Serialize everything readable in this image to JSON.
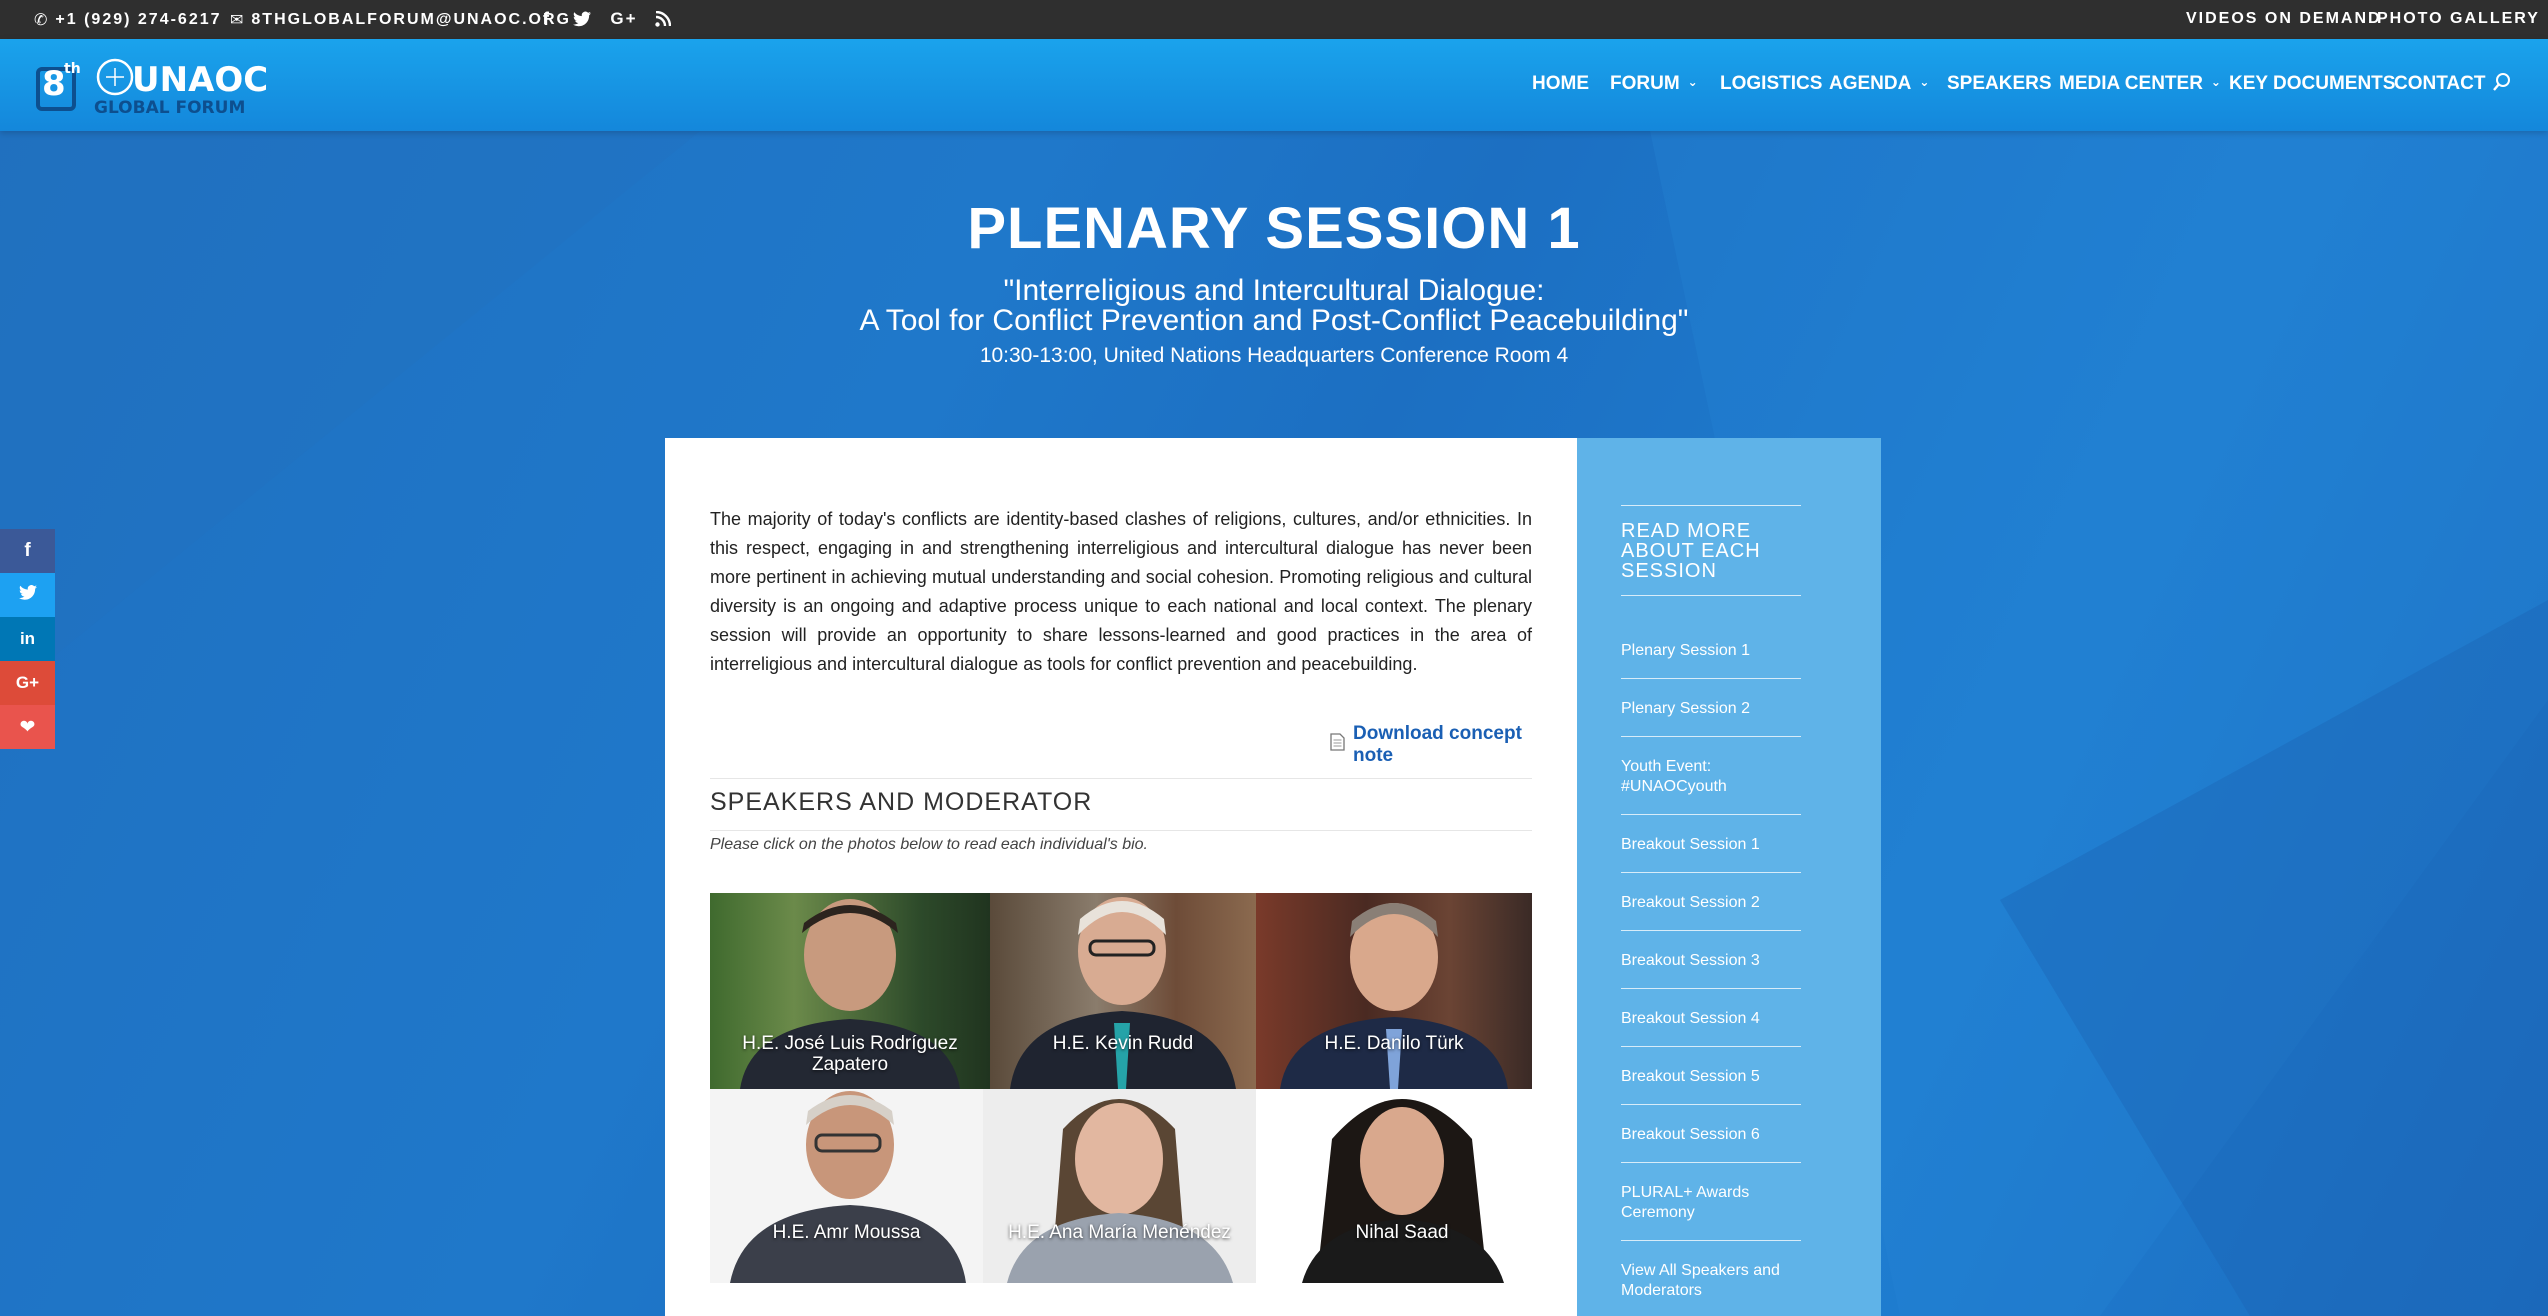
{
  "topbar": {
    "phone": "+1 (929) 274-6217",
    "email": "8THGLOBALFORUM@UNAOC.ORG",
    "social_icons": [
      "facebook-icon",
      "twitter-icon",
      "google-plus-icon",
      "rss-icon"
    ],
    "links": [
      "VIDEOS ON DEMAND",
      "PHOTO GALLERY"
    ]
  },
  "logo": {
    "number": "8",
    "superscript": "th",
    "brand": "UNAOC",
    "subtitle": "GLOBAL FORUM"
  },
  "nav": {
    "items": [
      {
        "label": "HOME",
        "dropdown": false
      },
      {
        "label": "FORUM",
        "dropdown": true
      },
      {
        "label": "LOGISTICS",
        "dropdown": false
      },
      {
        "label": "AGENDA",
        "dropdown": true
      },
      {
        "label": "SPEAKERS",
        "dropdown": false
      },
      {
        "label": "MEDIA CENTER",
        "dropdown": true
      },
      {
        "label": "KEY DOCUMENTS",
        "dropdown": false
      },
      {
        "label": "CONTACT",
        "dropdown": false
      }
    ],
    "search_icon": "search-icon"
  },
  "hero": {
    "title": "PLENARY SESSION 1",
    "subtitle_line1": "\"Interreligious and Intercultural Dialogue:",
    "subtitle_line2": "A Tool for Conflict Prevention and Post-Conflict Peacebuilding\"",
    "details": "10:30-13:00, United Nations Headquarters Conference Room 4"
  },
  "main": {
    "intro": "The majority of today's conflicts are identity-based clashes of religions, cultures, and/or ethnicities. In this respect, engaging in and strengthening interreligious and intercultural dialogue has never been more pertinent in achieving mutual understanding and social cohesion. Promoting religious and cultural diversity is an ongoing and adaptive process unique to each national and local context. The plenary session will provide an opportunity to share lessons-learned and good practices in the area of interreligious and intercultural dialogue as tools for conflict prevention and peacebuilding.",
    "download_label": "Download concept note",
    "section_title": "SPEAKERS AND MODERATOR",
    "note": "Please click on the photos below to read each individual's bio.",
    "speakers": [
      {
        "name": "H.E. José Luis Rodríguez Zapatero"
      },
      {
        "name": "H.E. Kevin Rudd"
      },
      {
        "name": "H.E. Danilo Türk"
      },
      {
        "name": "H.E. Amr Moussa"
      },
      {
        "name": "H.E. Ana María Menéndez"
      },
      {
        "name": "Nihal Saad"
      }
    ]
  },
  "sidebar": {
    "heading": "READ MORE ABOUT EACH SESSION",
    "items": [
      "Plenary Session 1",
      "Plenary Session 2",
      "Youth Event: #UNAOCyouth",
      "Breakout Session 1",
      "Breakout Session 2",
      "Breakout Session 3",
      "Breakout Session 4",
      "Breakout Session 5",
      "Breakout Session 6",
      "PLURAL+ Awards Ceremony",
      "View All Speakers and Moderators"
    ]
  },
  "share_bar": [
    {
      "icon": "facebook-icon",
      "color": "#3b5998"
    },
    {
      "icon": "twitter-icon",
      "color": "#1da1f2"
    },
    {
      "icon": "linkedin-icon",
      "color": "#0077b5"
    },
    {
      "icon": "google-plus-icon",
      "color": "#dd4b39"
    },
    {
      "icon": "heart-icon",
      "color": "#e9544d"
    }
  ]
}
